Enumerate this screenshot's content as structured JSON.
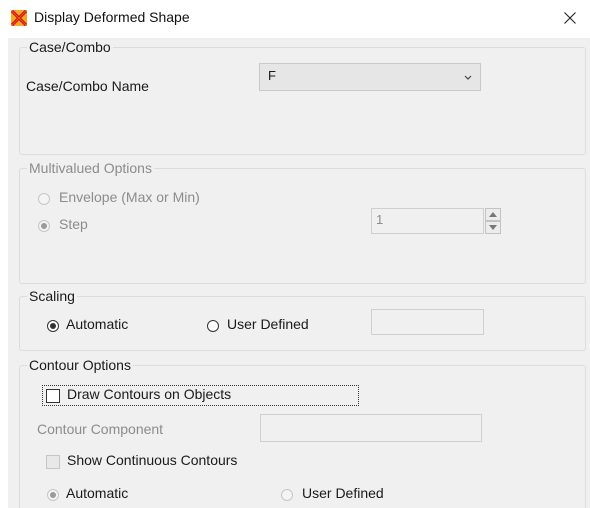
{
  "window": {
    "title": "Display Deformed Shape",
    "app_icon": "sap-app-icon",
    "close_icon": "close-icon"
  },
  "case_combo": {
    "group_label": "Case/Combo",
    "name_label": "Case/Combo Name",
    "selected_value": "F"
  },
  "multivalued": {
    "group_label": "Multivalued Options",
    "envelope_label": "Envelope (Max or Min)",
    "step_label": "Step",
    "step_value": "1",
    "selected": "Step",
    "enabled": false
  },
  "scaling": {
    "group_label": "Scaling",
    "automatic_label": "Automatic",
    "user_defined_label": "User Defined",
    "selected": "Automatic",
    "user_defined_value": ""
  },
  "contour": {
    "group_label": "Contour Options",
    "draw_contours_label": "Draw Contours on Objects",
    "draw_contours_checked": false,
    "component_label": "Contour Component",
    "component_value": "",
    "show_continuous_label": "Show Continuous Contours",
    "show_continuous_checked": false,
    "automatic_label": "Automatic",
    "user_defined_label": "User Defined",
    "selected": "Automatic"
  },
  "colors": {
    "dialog_background": "#f0f0f0",
    "disabled_text": "#8c8c8c",
    "group_border": "#dcdcdc"
  }
}
